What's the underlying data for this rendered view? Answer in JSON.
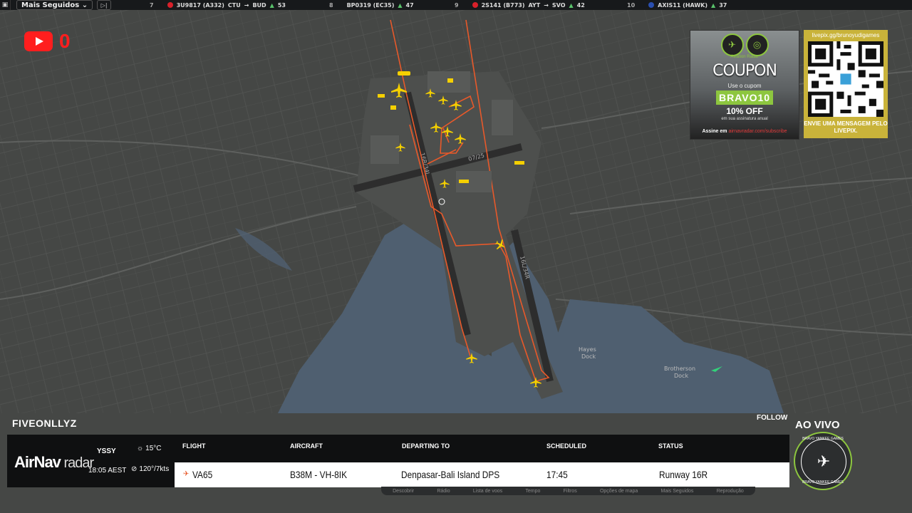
{
  "topbar": {
    "filter_label": "Mais Seguidos",
    "ticker": [
      {
        "rank": "7",
        "flight": "3U9817 (A332)",
        "from": "CTU",
        "to": "BUD",
        "count": "53",
        "flag": "#d8202a"
      },
      {
        "rank": "8",
        "flight": "BP0319 (EC35)",
        "count": "47",
        "flag": "#ffffff"
      },
      {
        "rank": "9",
        "flight": "2S141 (B773)",
        "from": "AYT",
        "to": "SVO",
        "count": "42",
        "flag": "#d8202a"
      },
      {
        "rank": "10",
        "flight": "AXIS11 (HAWK)",
        "count": "37",
        "flag": "#2a4fb0"
      }
    ]
  },
  "youtube": {
    "count": "0"
  },
  "map": {
    "runway_07_25": "07/25",
    "runway_16r_34l": "16R/34L",
    "runway_16l_34r": "16L/34R",
    "labels": [
      {
        "text": "Hayes\nDock"
      },
      {
        "text": "Brotherson\nDock"
      }
    ]
  },
  "coupon": {
    "brand": "Aviation Radar",
    "title": "COUPON",
    "subtitle": "Use o cupom",
    "code": "BRAVO10",
    "discount": "10% OFF",
    "fine_print": "em sua assinatura anual",
    "footer_prefix": "Assine em ",
    "footer_link": "airnavradar.com/subscribe"
  },
  "qr": {
    "url": "livepix.gg/brunoyudigames",
    "message": "ENVIE UMA MENSAGEM PELO LIVEPIX."
  },
  "flight_panel": {
    "callsign": "FIVEONLLYZ",
    "follow": "FOLLOW",
    "live": "AO VIVO",
    "brand_bold": "AirNav",
    "brand_light": " radar",
    "airport": "YSSY",
    "local_time": "18:05 AEST",
    "temperature": "15°C",
    "wind": "120°/7kts",
    "headers": {
      "flight": "FLIGHT",
      "aircraft": "AIRCRAFT",
      "departing": "DEPARTING TO",
      "scheduled": "SCHEDULED",
      "status": "STATUS"
    },
    "row": {
      "flight": "VA65",
      "aircraft": "B38M - VH-8IK",
      "departing": "Denpasar-Bali Island DPS",
      "scheduled": "17:45",
      "status": "Runway 16R"
    },
    "toolbar": [
      "Descobrir",
      "Rádio",
      "Lista de voos",
      "Tempo",
      "Filtros",
      "Opções de mapa",
      "Mais Seguidos",
      "Reprodução"
    ],
    "badge_top": "BRAVO YANKEE GAMES",
    "badge_bottom": "BRAVO YANKEE GAMES"
  },
  "colors": {
    "track": "#e8592a",
    "aircraft": "#f5d000",
    "runway": "#2d2d2d",
    "water": "#4f5f70",
    "land": "#454745"
  }
}
